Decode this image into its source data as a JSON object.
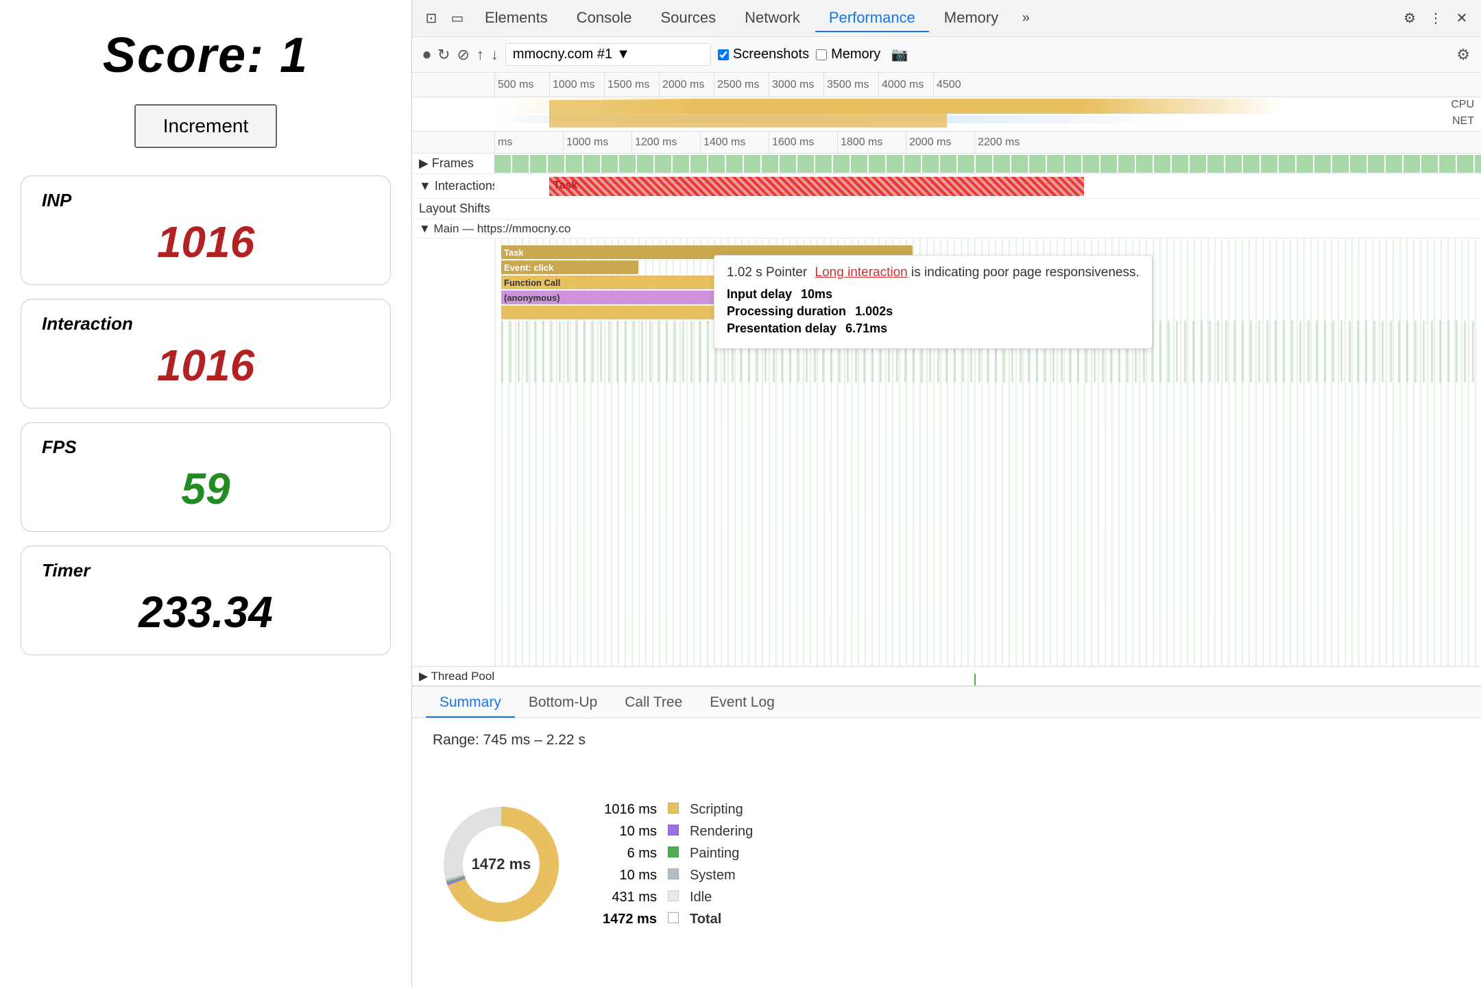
{
  "left": {
    "score_label": "Score: 1",
    "increment_btn": "Increment",
    "metrics": [
      {
        "id": "inp",
        "label": "INP",
        "value": "1016",
        "color": "red"
      },
      {
        "id": "interaction",
        "label": "Interaction",
        "value": "1016",
        "color": "red"
      },
      {
        "id": "fps",
        "label": "FPS",
        "value": "59",
        "color": "green"
      },
      {
        "id": "timer",
        "label": "Timer",
        "value": "233.34",
        "color": "black"
      }
    ]
  },
  "devtools": {
    "tabs": [
      "Elements",
      "Console",
      "Sources",
      "Network",
      "Performance",
      "Memory"
    ],
    "active_tab": "Performance",
    "toolbar": {
      "record": "⏺",
      "reload": "↻",
      "clear": "⊘",
      "upload": "↑",
      "download": "↓",
      "url": "mmocny.com #1",
      "screenshots_label": "Screenshots",
      "memory_label": "Memory"
    },
    "timeline": {
      "ruler_marks": [
        "500 ms",
        "1000 ms",
        "1500 ms",
        "2000 ms",
        "2500 ms",
        "3000 ms",
        "3500 ms",
        "4000 ms",
        "4500"
      ],
      "ruler2_marks": [
        "ms",
        "1000 ms",
        "1200 ms",
        "1400 ms",
        "1600 ms",
        "1800 ms",
        "2000 ms",
        "2200 ms"
      ],
      "cpu_label": "CPU",
      "net_label": "NET",
      "frames_label": "▶ Frames",
      "interactions_label": "▼ Interactions",
      "layout_shifts_label": "Layout Shifts",
      "main_label": "▼ Main — https://mmocny.co",
      "thread_pool_label": "▶ Thread Pool"
    },
    "tooltip": {
      "header": "1.02 s  Pointer",
      "link_text": "Long interaction",
      "suffix": " is indicating poor page responsiveness.",
      "input_delay_label": "Input delay",
      "input_delay_value": "10ms",
      "processing_label": "Processing duration",
      "processing_value": "1.002s",
      "presentation_label": "Presentation delay",
      "presentation_value": "6.71ms"
    },
    "flame": {
      "task_label": "Task",
      "event_click_label": "Event: click",
      "function_call_label": "Function Call",
      "anonymous_label": "(anonymous)"
    },
    "bottom": {
      "tabs": [
        "Summary",
        "Bottom-Up",
        "Call Tree",
        "Event Log"
      ],
      "active_tab": "Summary",
      "range_label": "Range: 745 ms – 2.22 s",
      "donut_center": "1472 ms",
      "legend": [
        {
          "ms": "1016 ms",
          "label": "Scripting",
          "color": "#e8c060"
        },
        {
          "ms": "10 ms",
          "label": "Rendering",
          "color": "#9c6fe4"
        },
        {
          "ms": "6 ms",
          "label": "Painting",
          "color": "#4caf50"
        },
        {
          "ms": "10 ms",
          "label": "System",
          "color": "#b0bec5"
        },
        {
          "ms": "431 ms",
          "label": "Idle",
          "color": "#e0e0e0"
        },
        {
          "ms": "1472 ms",
          "label": "Total",
          "color": "#ffffff"
        }
      ]
    }
  }
}
